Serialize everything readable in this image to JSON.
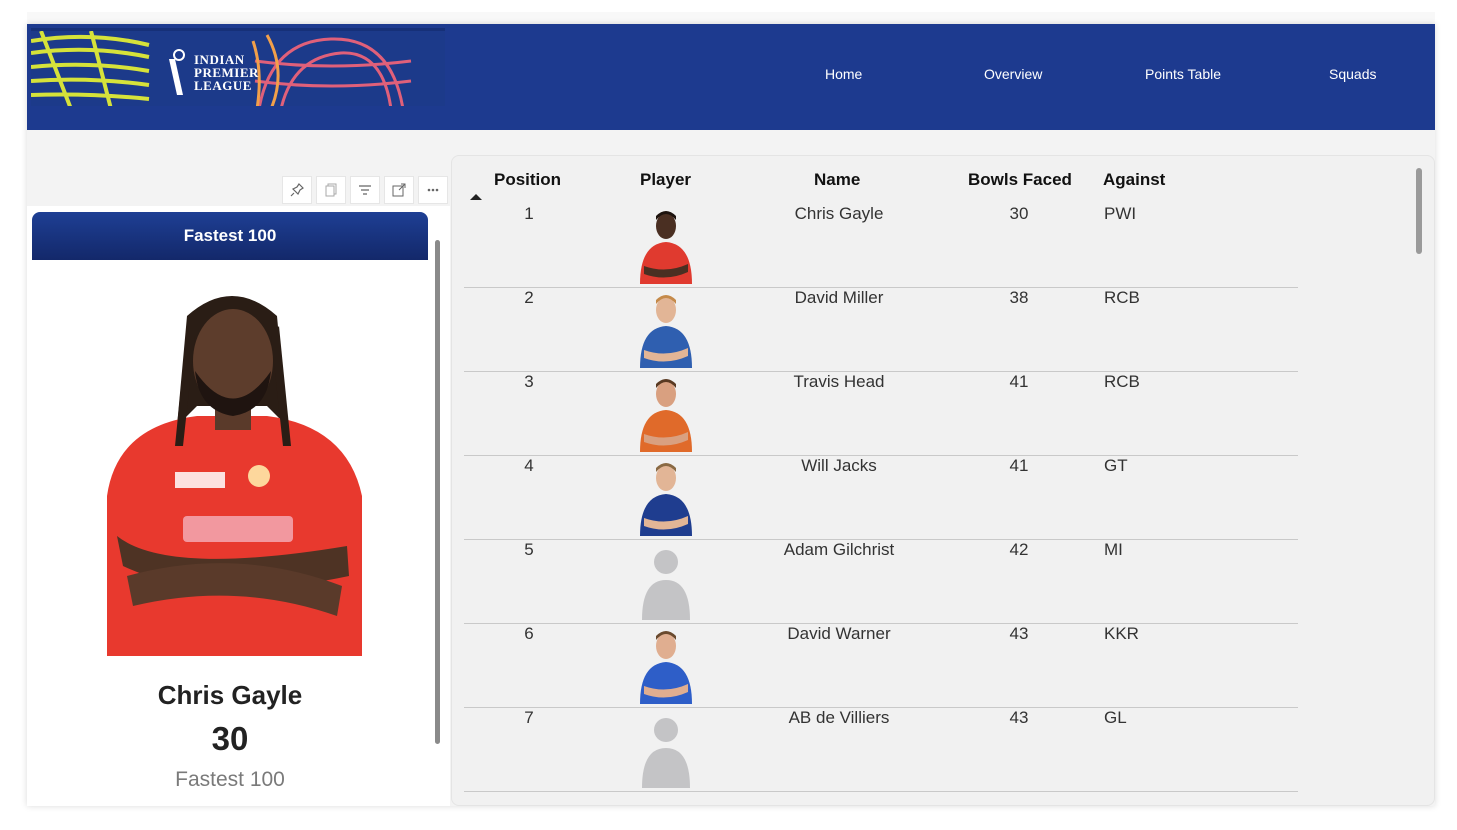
{
  "nav": {
    "logo_text": [
      "INDIAN",
      "PREMIER",
      "LEAGUE"
    ],
    "links": [
      "Home",
      "Overview",
      "Points Table",
      "Squads"
    ]
  },
  "toolbar_icons": [
    "pin-icon",
    "copy-icon",
    "filter-icon",
    "focus-mode-icon",
    "more-options-icon"
  ],
  "card": {
    "header": "Fastest 100",
    "name": "Chris Gayle",
    "value": "30",
    "caption": "Fastest 100"
  },
  "table": {
    "headers": [
      "Position",
      "Player",
      "Name",
      "Bowls Faced",
      "Against"
    ],
    "rows": [
      {
        "position": "1",
        "name": "Chris Gayle",
        "balls": "30",
        "against": "PWI",
        "photo": "red"
      },
      {
        "position": "2",
        "name": "David Miller",
        "balls": "38",
        "against": "RCB",
        "photo": "blue"
      },
      {
        "position": "3",
        "name": "Travis Head",
        "balls": "41",
        "against": "RCB",
        "photo": "orange"
      },
      {
        "position": "4",
        "name": "Will Jacks",
        "balls": "41",
        "against": "GT",
        "photo": "navy"
      },
      {
        "position": "5",
        "name": "Adam Gilchrist",
        "balls": "42",
        "against": "MI",
        "photo": "silhouette"
      },
      {
        "position": "6",
        "name": "David Warner",
        "balls": "43",
        "against": "KKR",
        "photo": "dc"
      },
      {
        "position": "7",
        "name": "AB de Villiers",
        "balls": "43",
        "against": "GL",
        "photo": "silhouette"
      }
    ]
  },
  "colors": {
    "navbar": "#1d3a8f",
    "card_header": "#1a3480"
  }
}
